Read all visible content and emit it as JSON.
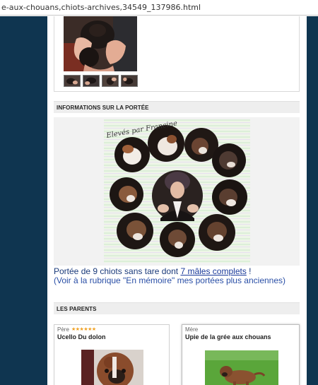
{
  "browser": {
    "url": "e-aux-chouans,chiots-archives,34549_137986.html"
  },
  "sections": {
    "litter_info_title": "INFORMATIONS SUR LA PORTÉE",
    "parents_title": "LES PARENTS"
  },
  "gallery": {
    "main_photo_alt": "chiots",
    "thumbnail_count": 4
  },
  "collage": {
    "caption": "Elevés par Francine"
  },
  "litter": {
    "text_before": "Portée de 9 chiots sans tare dont ",
    "link_text": "7 mâles complets",
    "text_after": " !",
    "note": "(Voir à la rubrique \"En mémoire\" mes portées plus anciennes)"
  },
  "parents": {
    "father": {
      "role": "Père",
      "stars": "★★★★★★",
      "name": "Ucello Du dolon"
    },
    "mother": {
      "role": "Mère",
      "name": "Upie de la grée aux chouans"
    }
  },
  "colors": {
    "background": "#0f3550",
    "section_header_bg": "#eeeeee",
    "litter_text": "#1a3a7a",
    "stars": "#f0a020"
  }
}
